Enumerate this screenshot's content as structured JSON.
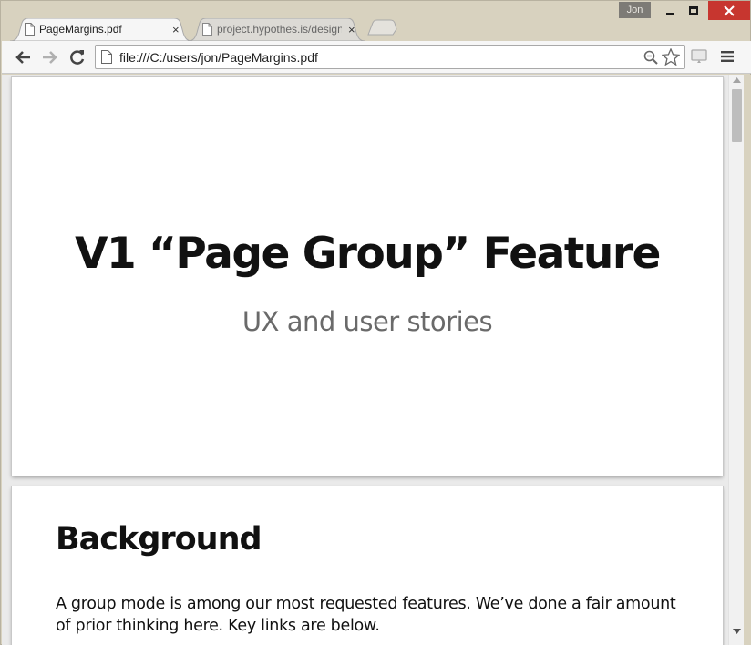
{
  "window": {
    "profile_name": "Jon",
    "colors": {
      "frame": "#d8d2bf",
      "close": "#c7362f",
      "toolbar": "#f6f6f6"
    }
  },
  "tabs": [
    {
      "title": "PageMargins.pdf",
      "active": true,
      "icon": "document-icon",
      "close": "×"
    },
    {
      "title": "project.hypothes.is/design",
      "active": false,
      "icon": "document-icon",
      "close": "×"
    }
  ],
  "toolbar": {
    "url": "file:///C:/users/jon/PageMargins.pdf",
    "icons": [
      "back-arrow-icon",
      "forward-arrow-icon",
      "reload-icon",
      "page-icon",
      "zoom-icon",
      "star-icon",
      "cast-icon",
      "menu-icon"
    ]
  },
  "document": {
    "page1": {
      "title": "V1 “Page Group” Feature",
      "subtitle": "UX and user stories"
    },
    "page2": {
      "heading": "Background",
      "paragraph_line1": "A group mode is among our most requested features.  We’ve done a fair amount",
      "paragraph_line2": "of prior thinking here.  Key links are below."
    }
  }
}
